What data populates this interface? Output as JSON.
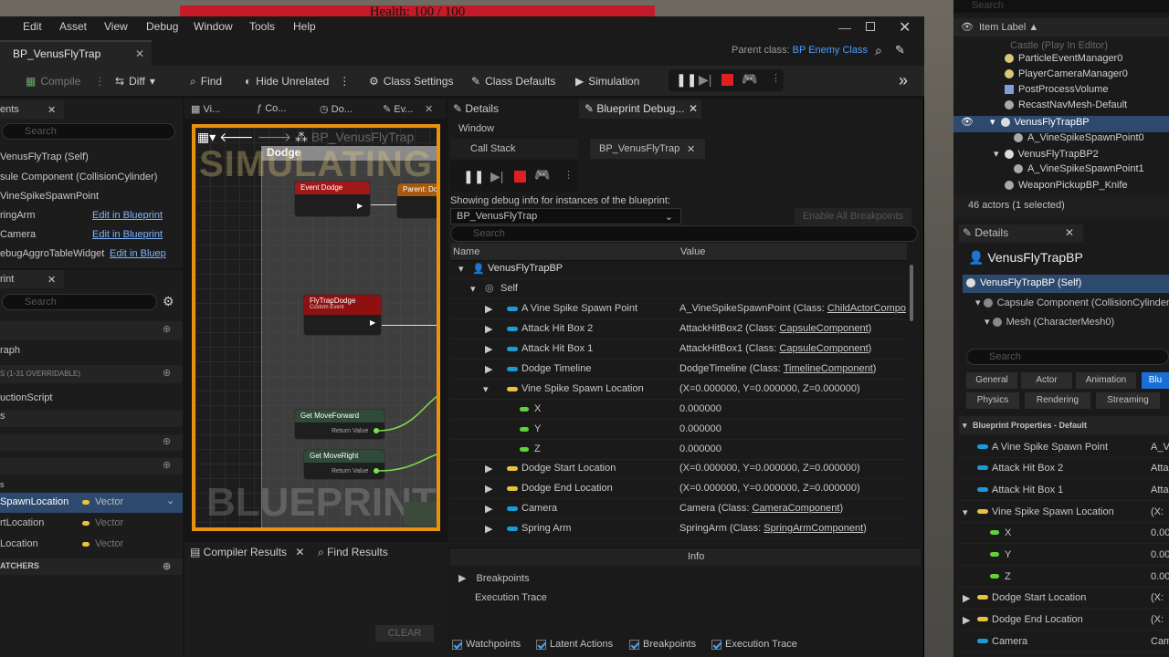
{
  "hud": {
    "health": "Health: 100 / 100"
  },
  "menu": [
    "Edit",
    "Asset",
    "View",
    "Debug",
    "Window",
    "Tools",
    "Help"
  ],
  "doc_tab": "BP_VenusFlyTrap",
  "parent_class_label": "Parent class:",
  "parent_class": "BP Enemy Class",
  "toolbar": {
    "compile": "Compile",
    "diff": "Diff",
    "find": "Find",
    "hide_unrelated": "Hide Unrelated",
    "class_settings": "Class Settings",
    "class_defaults": "Class Defaults",
    "simulation": "Simulation"
  },
  "components": {
    "title": "ents",
    "search": "Search",
    "items": [
      {
        "label": "VenusFlyTrap (Self)"
      },
      {
        "label": "sule Component (CollisionCylinder)"
      },
      {
        "label": "VineSpikeSpawnPoint"
      },
      {
        "label": "ringArm",
        "link": "Edit in Blueprint"
      },
      {
        "label": "Camera",
        "link": "Edit in Blueprint"
      },
      {
        "label": "ebugAggroTableWidget",
        "link": "Edit in Bluep"
      }
    ]
  },
  "mybp": {
    "title": "rint",
    "search": "Search",
    "items": [
      "raph",
      "S (1-31 OVERRIDABLE)",
      "uctionScript",
      "s",
      "s"
    ],
    "vars": [
      {
        "name": "SpawnLocation",
        "type": "Vector"
      },
      {
        "name": "rtLocation",
        "type": "Vector"
      },
      {
        "name": "Location",
        "type": "Vector"
      }
    ],
    "dispatchers": "ATCHERS"
  },
  "graph_tabs": [
    "Vi...",
    "Co...",
    "Do...",
    "Ev..."
  ],
  "graph": {
    "crumb": "BP_VenusFlyTrap",
    "section": "Dodge",
    "simulating": "SIMULATING",
    "watermark": "BLUEPRINT",
    "nodes": {
      "event_dodge": "Event Dodge",
      "parent": "Parent: Dodge",
      "flytrap_dodge": "FlyTrapDodge",
      "custom_event": "Custom Event",
      "get_forward": "Get MoveForward",
      "return_value": "Return Value",
      "get_right": "Get MoveRight",
      "return_value2": "Return Value"
    }
  },
  "bottom_tabs": {
    "compiler": "Compiler Results",
    "find": "Find Results",
    "clear": "CLEAR"
  },
  "debug": {
    "tab_details": "Details",
    "tab_debug": "Blueprint Debug...",
    "window": "Window",
    "call_stack": "Call Stack",
    "instance_tab": "BP_VenusFlyTrap",
    "showing": "Showing debug info for instances of the blueprint:",
    "instance": "BP_VenusFlyTrap",
    "enable_all": "Enable All Breakpoints",
    "search": "Search",
    "col_name": "Name",
    "col_value": "Value",
    "rows": [
      {
        "name": "VenusFlyTrapBP",
        "value": ""
      },
      {
        "name": "Self",
        "value": ""
      },
      {
        "name": "A Vine Spike Spawn Point",
        "value": "A_VineSpikeSpawnPoint (Class: ",
        "link": "ChildActorCompo"
      },
      {
        "name": "Attack Hit Box 2",
        "value": "AttackHitBox2 (Class: ",
        "link": "CapsuleComponent",
        "tail": ")"
      },
      {
        "name": "Attack Hit Box 1",
        "value": "AttackHitBox1 (Class: ",
        "link": "CapsuleComponent",
        "tail": ")"
      },
      {
        "name": "Dodge Timeline",
        "value": "DodgeTimeline (Class: ",
        "link": "TimelineComponent",
        "tail": ")"
      },
      {
        "name": "Vine Spike Spawn Location",
        "value": "(X=0.000000, Y=0.000000, Z=0.000000)"
      },
      {
        "name": "X",
        "value": "0.000000"
      },
      {
        "name": "Y",
        "value": "0.000000"
      },
      {
        "name": "Z",
        "value": "0.000000"
      },
      {
        "name": "Dodge Start Location",
        "value": "(X=0.000000, Y=0.000000, Z=0.000000)"
      },
      {
        "name": "Dodge End Location",
        "value": "(X=0.000000, Y=0.000000, Z=0.000000)"
      },
      {
        "name": "Camera",
        "value": "Camera (Class: ",
        "link": "CameraComponent",
        "tail": ")"
      },
      {
        "name": "Spring Arm",
        "value": "SpringArm (Class: ",
        "link": "SpringArmComponent",
        "tail": ")"
      }
    ],
    "info": "Info",
    "breakpoints": "Breakpoints",
    "exec_trace": "Execution Trace",
    "checks": [
      "Watchpoints",
      "Latent Actions",
      "Breakpoints",
      "Execution Trace"
    ]
  },
  "outliner": {
    "search": "Search",
    "item_label": "Item Label",
    "items": [
      "Castle (Play In Editor)",
      "ParticleEventManager0",
      "PlayerCameraManager0",
      "PostProcessVolume",
      "RecastNavMesh-Default",
      "VenusFlyTrapBP",
      "A_VineSpikeSpawnPoint0",
      "VenusFlyTrapBP2",
      "A_VineSpikeSpawnPoint1",
      "WeaponPickupBP_Knife"
    ],
    "count": "46 actors (1 selected)"
  },
  "details": {
    "tab": "Details",
    "title": "VenusFlyTrapBP",
    "self": "VenusFlyTrapBP (Self)",
    "capsule": "Capsule Component (CollisionCylinder)",
    "mesh": "Mesh (CharacterMesh0)",
    "search": "Search",
    "filters": [
      "General",
      "Actor",
      "Animation",
      "Blu"
    ],
    "filters2": [
      "Physics",
      "Rendering",
      "Streaming"
    ],
    "section": "Blueprint Properties - Default",
    "props": [
      {
        "name": "A Vine Spike Spawn Point",
        "value": "A_V"
      },
      {
        "name": "Attack Hit Box 2",
        "value": "Atta"
      },
      {
        "name": "Attack Hit Box 1",
        "value": "Atta"
      },
      {
        "name": "Vine Spike Spawn Location",
        "value": "(X:"
      },
      {
        "name": "X",
        "value": "0.00"
      },
      {
        "name": "Y",
        "value": "0.00"
      },
      {
        "name": "Z",
        "value": "0.00"
      },
      {
        "name": "Dodge Start Location",
        "value": "(X:"
      },
      {
        "name": "Dodge End Location",
        "value": "(X:"
      },
      {
        "name": "Camera",
        "value": "Cam"
      }
    ]
  }
}
